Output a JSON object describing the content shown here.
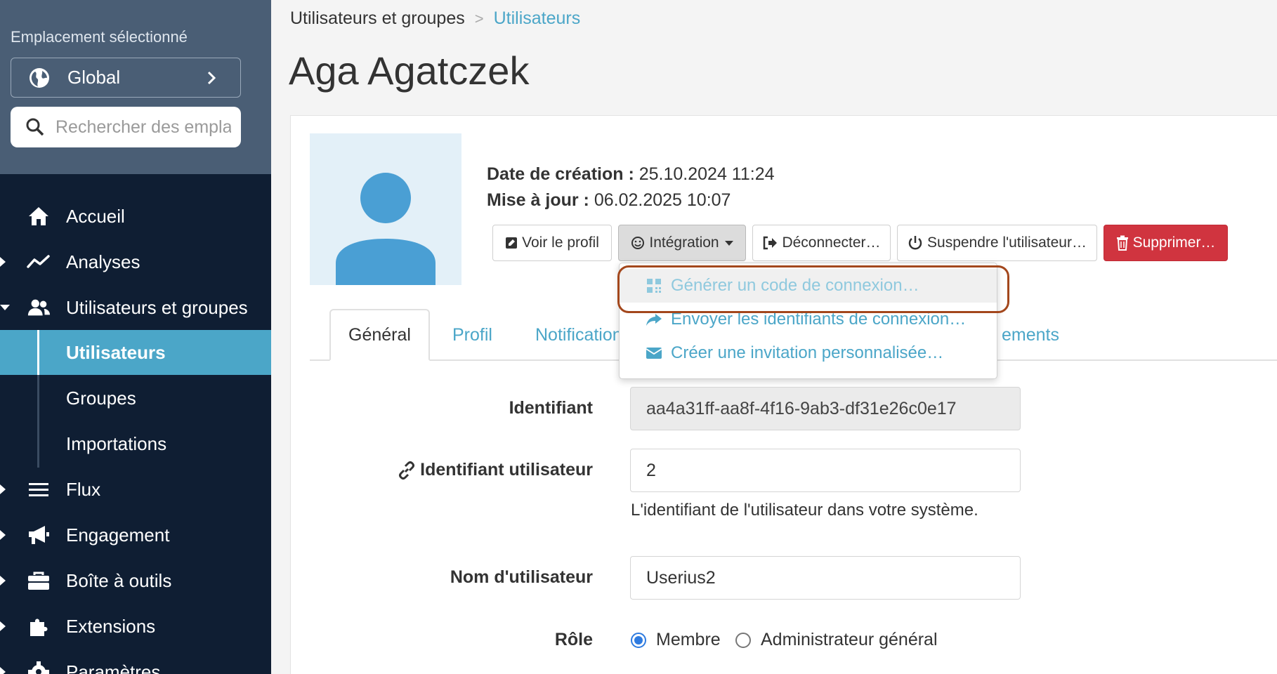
{
  "sidebar": {
    "location_label": "Emplacement sélectionné",
    "location_value": "Global",
    "search_placeholder": "Rechercher des emplacements",
    "nav": [
      {
        "label": "Accueil",
        "icon": "home-icon"
      },
      {
        "label": "Analyses",
        "icon": "analytics-icon"
      },
      {
        "label": "Utilisateurs et groupes",
        "icon": "users-icon"
      },
      {
        "label": "Flux",
        "icon": "menu-lines-icon"
      },
      {
        "label": "Engagement",
        "icon": "megaphone-icon"
      },
      {
        "label": "Boîte à outils",
        "icon": "toolbox-icon"
      },
      {
        "label": "Extensions",
        "icon": "puzzle-icon"
      },
      {
        "label": "Paramètres",
        "icon": "gear-icon"
      }
    ],
    "sub": [
      {
        "label": "Utilisateurs"
      },
      {
        "label": "Groupes"
      },
      {
        "label": "Importations"
      }
    ]
  },
  "breadcrumb": {
    "parent": "Utilisateurs et groupes",
    "sep": ">",
    "current": "Utilisateurs"
  },
  "title": "Aga Agatczek",
  "meta": {
    "created_label": "Date de création :",
    "created_value": "25.10.2024 11:24",
    "updated_label": "Mise à jour :",
    "updated_value": "06.02.2025 10:07"
  },
  "actions": {
    "view_profile": "Voir le profil",
    "integration": "Intégration",
    "logout": "Déconnecter…",
    "suspend": "Suspendre l'utilisateur…",
    "delete": "Supprimer…"
  },
  "dropdown": [
    {
      "label": "Générer un code de connexion…",
      "icon": "qr-code-icon"
    },
    {
      "label": "Envoyer les identifiants de connexion…",
      "icon": "share-arrow-icon"
    },
    {
      "label": "Créer une invitation personnalisée…",
      "icon": "envelope-icon"
    }
  ],
  "tabs": {
    "general": "Général",
    "profile": "Profil",
    "notifications": "Notifications",
    "last_partial": "ements"
  },
  "form": {
    "id_label": "Identifiant",
    "id_value": "aa4a31ff-aa8f-4f16-9ab3-df31e26c0e17",
    "user_id_label": "Identifiant utilisateur",
    "user_id_value": "2",
    "user_id_help": "L'identifiant de l'utilisateur dans votre système.",
    "username_label": "Nom d'utilisateur",
    "username_value": "Userius2",
    "role_label": "Rôle",
    "role_options": [
      "Membre",
      "Administrateur général"
    ],
    "role_selected": "Membre"
  },
  "colors": {
    "sidebar_bg": "#0f1e33",
    "accent": "#4ba6c8",
    "danger": "#d0343f",
    "highlight": "#a3471c"
  }
}
